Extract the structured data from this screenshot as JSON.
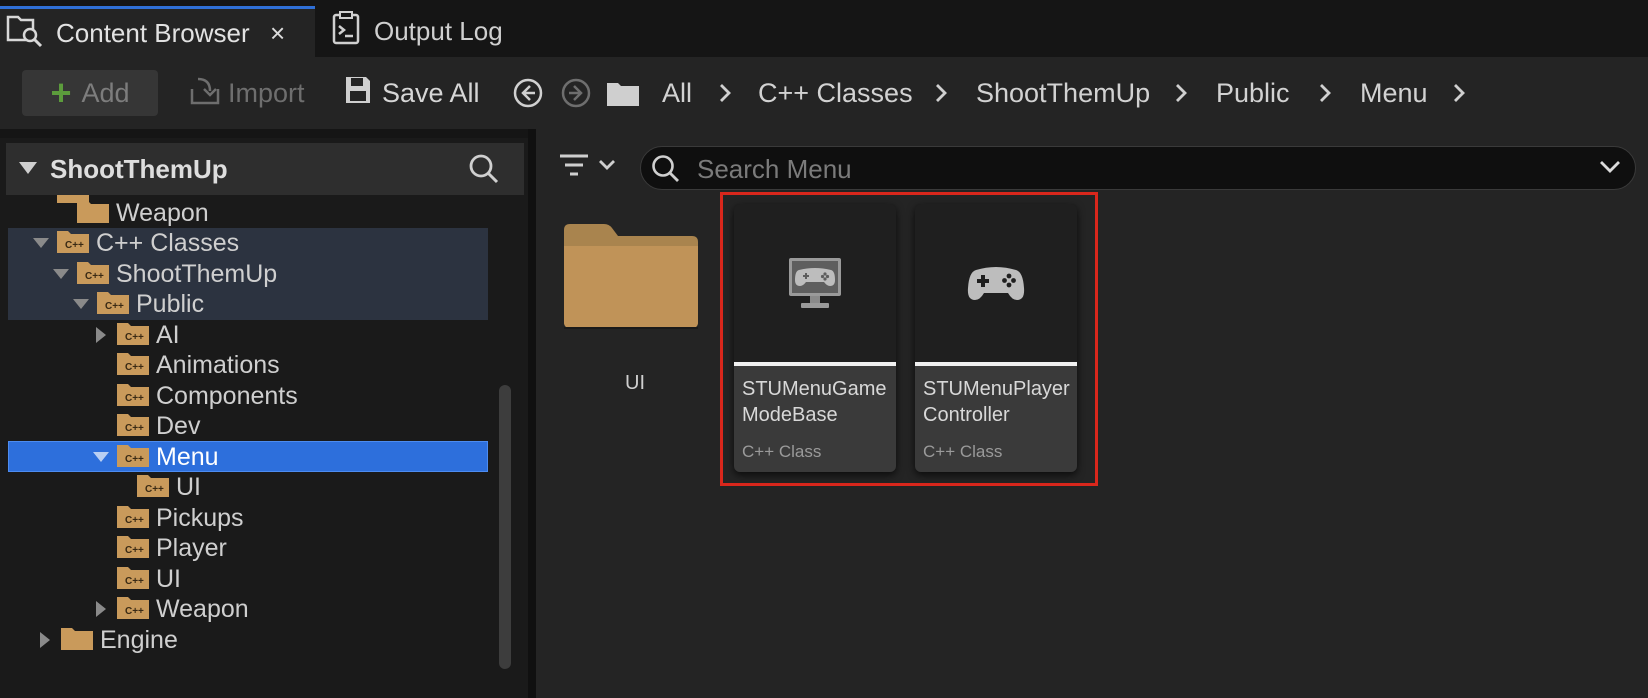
{
  "tabs": [
    {
      "label": "Content Browser",
      "close": "×",
      "active": true
    },
    {
      "label": "Output Log",
      "active": false
    }
  ],
  "toolbar": {
    "add_label": "Add",
    "import_label": "Import",
    "save_all_label": "Save All"
  },
  "breadcrumb": [
    "All",
    "C++ Classes",
    "ShootThemUp",
    "Public",
    "Menu"
  ],
  "tree": {
    "title": "ShootThemUp",
    "rows": [
      {
        "label": "Weapon"
      },
      {
        "label": "C++ Classes"
      },
      {
        "label": "ShootThemUp"
      },
      {
        "label": "Public"
      },
      {
        "label": "AI"
      },
      {
        "label": "Animations"
      },
      {
        "label": "Components"
      },
      {
        "label": "Dev"
      },
      {
        "label": "Menu"
      },
      {
        "label": "UI"
      },
      {
        "label": "Pickups"
      },
      {
        "label": "Player"
      },
      {
        "label": "UI"
      },
      {
        "label": "Weapon"
      },
      {
        "label": "Engine"
      }
    ]
  },
  "search": {
    "placeholder": "Search Menu"
  },
  "assets": {
    "folder": {
      "label": "UI"
    },
    "cards": [
      {
        "name": "STUMenuGame ModeBase",
        "type": "C++ Class",
        "icon": "monitor-gamepad-icon"
      },
      {
        "name": "STUMenuPlayer Controller",
        "type": "C++ Class",
        "icon": "gamepad-icon"
      }
    ]
  },
  "colors": {
    "selection_blue": "#2d6fdc",
    "highlight_outline": "#d9271c",
    "add_plus_green": "#5c9c3c",
    "folder_tan": "#c99a5b"
  }
}
